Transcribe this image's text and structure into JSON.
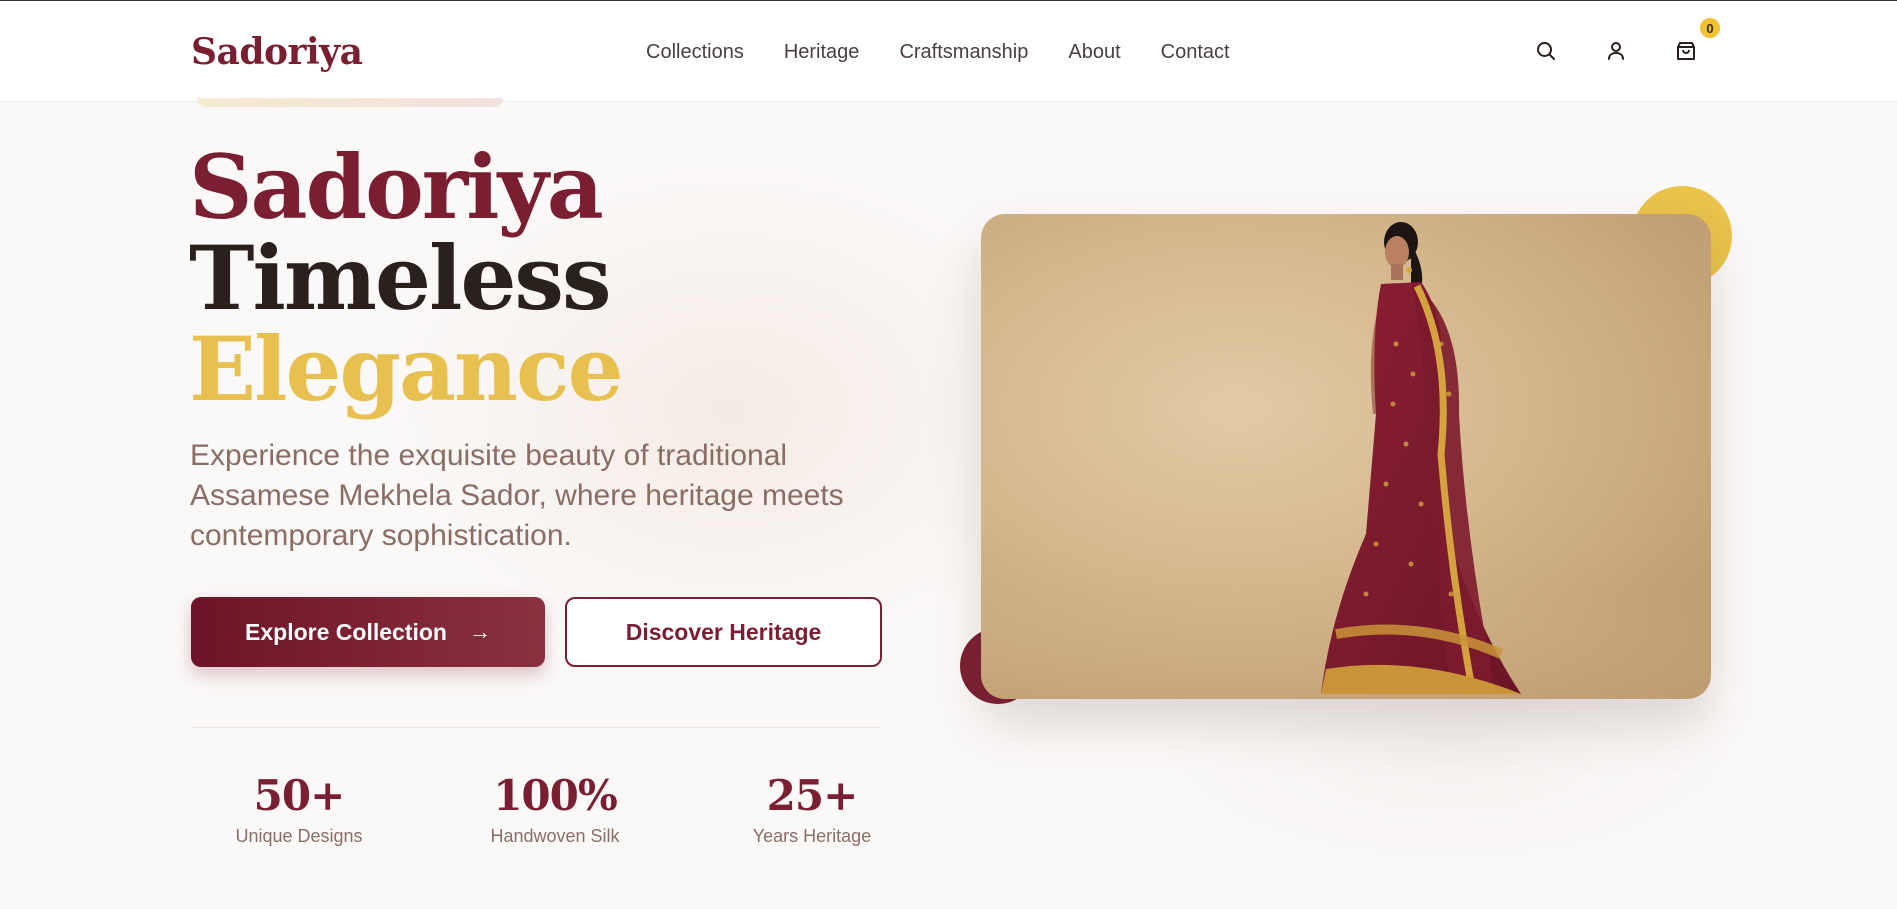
{
  "brand": {
    "name": "Sadoriya",
    "color": "#7a1f32",
    "accent": "#e8c04f"
  },
  "nav": {
    "items": [
      {
        "label": "Collections"
      },
      {
        "label": "Heritage"
      },
      {
        "label": "Craftsmanship"
      },
      {
        "label": "About"
      },
      {
        "label": "Contact"
      }
    ]
  },
  "header_icons": {
    "search": "search-icon",
    "account": "user-icon",
    "cart": "shopping-bag-icon",
    "cart_count": "0"
  },
  "hero": {
    "line1": "Sadoriya",
    "line2": "Timeless",
    "line3": "Elegance",
    "description": "Experience the exquisite beauty of traditional Assamese Mekhela Sador, where heritage meets contemporary sophistication.",
    "primary_cta": "Explore Collection",
    "primary_cta_icon": "arrow-right-icon",
    "secondary_cta": "Discover Heritage"
  },
  "stats": [
    {
      "value": "50+",
      "label": "Unique Designs"
    },
    {
      "value": "100%",
      "label": "Handwoven Silk"
    },
    {
      "value": "25+",
      "label": "Years Heritage"
    }
  ]
}
